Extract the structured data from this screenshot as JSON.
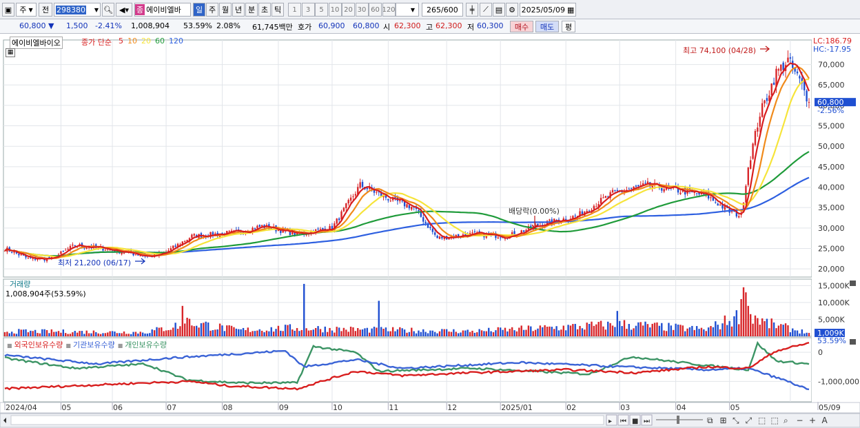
{
  "toolbar": {
    "market": "주",
    "prev_label": "전",
    "code": "298380",
    "type_badge": "종",
    "name": "에이비엘바",
    "periods": [
      "일",
      "주",
      "월",
      "년",
      "분",
      "초",
      "틱"
    ],
    "intervals": [
      "1",
      "3",
      "5",
      "10",
      "20",
      "30",
      "60",
      "120"
    ],
    "count": "265",
    "count_total": "/600",
    "date": "2025/05/09"
  },
  "quote": {
    "price": "60,800",
    "change": "1,500",
    "change_pct": "-2.41%",
    "volume": "1,008,904",
    "volume_ratio": "53.59%",
    "turnover": "2.08%",
    "amount": "61,745백만",
    "bid_label": "호가",
    "bid1": "60,900",
    "bid2": "60,800",
    "open_label": "시",
    "open": "62,300",
    "high_label": "고",
    "high": "62,300",
    "low_label": "저",
    "low": "60,300",
    "buy": "매수",
    "sell": "매도",
    "avg": "평"
  },
  "price_panel": {
    "stock_name": "에이비엘바이오",
    "ma_label": "종가 단순",
    "ma_periods": [
      "5",
      "10",
      "20",
      "60",
      "120"
    ],
    "lc": "LC:186.79",
    "hc": "HC:-17.95",
    "high_note": "최고 74,100 (04/28)",
    "low_note": "최저 21,200 (06/17)",
    "dividend_note": "배당락(0.00%)",
    "current_tag": "60,800",
    "current_pct": "-2.56%"
  },
  "volume_panel": {
    "title": "거래량",
    "value": "1,008,904주(53.59%)",
    "current_tag": "1,009K",
    "current_pct": "53.59%"
  },
  "holdings_panel": {
    "legend": [
      "외국인보유수량",
      "기관보유수량",
      "개인보유수량"
    ]
  },
  "colors": {
    "up": "#d8262a",
    "down": "#1f4fd1",
    "ma5": "#d81e1e",
    "ma10": "#f08a1a",
    "ma20": "#f6e43a",
    "ma60": "#1f9b3a",
    "ma120": "#2d5fe0",
    "foreign": "#d81e1e",
    "institution": "#3a63d6",
    "individual": "#3b9464"
  },
  "chart_data": {
    "type": "candlestick",
    "x": [
      "2024/04",
      "05",
      "06",
      "07",
      "08",
      "09",
      "10",
      "11",
      "12",
      "2025/01",
      "02",
      "03",
      "04",
      "05",
      "05/09"
    ],
    "price_axis": {
      "ylim": [
        18000,
        76000
      ],
      "ticks": [
        "70,000",
        "65,000",
        "60,000",
        "55,000",
        "50,000",
        "45,000",
        "40,000",
        "35,000",
        "30,000",
        "25,000",
        "20,000"
      ]
    },
    "volume_axis": {
      "ticks": [
        "15,000K",
        "10,000K",
        "5,000K"
      ]
    },
    "holdings_axis": {
      "ticks": [
        "0",
        "-1,000,000"
      ]
    },
    "price_anchors": [
      [
        0,
        25000
      ],
      [
        10,
        22500
      ],
      [
        20,
        22500
      ],
      [
        30,
        25800
      ],
      [
        42,
        25000
      ],
      [
        62,
        23000
      ],
      [
        68,
        23800
      ],
      [
        80,
        28000
      ],
      [
        100,
        29000
      ],
      [
        110,
        30500
      ],
      [
        125,
        28500
      ],
      [
        140,
        30000
      ],
      [
        152,
        40500
      ],
      [
        165,
        37000
      ],
      [
        175,
        35000
      ],
      [
        185,
        27500
      ],
      [
        200,
        28500
      ],
      [
        215,
        28000
      ],
      [
        230,
        31000
      ],
      [
        245,
        33000
      ],
      [
        260,
        38500
      ],
      [
        275,
        40500
      ],
      [
        290,
        39000
      ],
      [
        300,
        38000
      ],
      [
        310,
        34000
      ],
      [
        315,
        33000
      ],
      [
        318,
        45000
      ],
      [
        323,
        58000
      ],
      [
        326,
        62000
      ],
      [
        330,
        68000
      ],
      [
        335,
        71000
      ],
      [
        340,
        66000
      ],
      [
        344,
        60800
      ]
    ],
    "volume_anchors": [
      [
        0,
        1500
      ],
      [
        60,
        1200
      ],
      [
        80,
        4000
      ],
      [
        100,
        1800
      ],
      [
        125,
        2500
      ],
      [
        150,
        2000
      ],
      [
        200,
        1500
      ],
      [
        265,
        3500
      ],
      [
        300,
        2000
      ],
      [
        318,
        7000
      ],
      [
        325,
        4000
      ],
      [
        344,
        1009
      ]
    ],
    "volume_spikes": [
      [
        76,
        9000
      ],
      [
        78,
        5500
      ],
      [
        128,
        15500
      ],
      [
        160,
        10500
      ],
      [
        262,
        7500
      ],
      [
        315,
        11000
      ],
      [
        316,
        14500
      ],
      [
        317,
        13000
      ],
      [
        318,
        9000
      ]
    ],
    "foreign_anchors": [
      [
        0,
        -1250000
      ],
      [
        30,
        -1150000
      ],
      [
        60,
        -1050000
      ],
      [
        80,
        -1000000
      ],
      [
        95,
        -1150000
      ],
      [
        125,
        -1250000
      ],
      [
        150,
        -650000
      ],
      [
        170,
        -800000
      ],
      [
        200,
        -700000
      ],
      [
        240,
        -600000
      ],
      [
        270,
        -700000
      ],
      [
        300,
        -500000
      ],
      [
        318,
        -550000
      ],
      [
        330,
        50000
      ],
      [
        344,
        320000
      ]
    ],
    "institution_anchors": [
      [
        0,
        -100000
      ],
      [
        40,
        -400000
      ],
      [
        70,
        -200000
      ],
      [
        120,
        50000
      ],
      [
        128,
        -500000
      ],
      [
        150,
        -250000
      ],
      [
        170,
        -550000
      ],
      [
        220,
        -350000
      ],
      [
        265,
        -500000
      ],
      [
        300,
        -600000
      ],
      [
        318,
        -550000
      ],
      [
        335,
        -1000000
      ],
      [
        344,
        -1300000
      ]
    ],
    "individual_anchors": [
      [
        0,
        -200000
      ],
      [
        30,
        -550000
      ],
      [
        60,
        -400000
      ],
      [
        78,
        -950000
      ],
      [
        100,
        -1050000
      ],
      [
        125,
        -1050000
      ],
      [
        132,
        200000
      ],
      [
        150,
        0
      ],
      [
        160,
        -650000
      ],
      [
        200,
        -550000
      ],
      [
        250,
        -750000
      ],
      [
        268,
        -150000
      ],
      [
        300,
        -450000
      ],
      [
        318,
        -600000
      ],
      [
        322,
        300000
      ],
      [
        330,
        -300000
      ],
      [
        344,
        -400000
      ]
    ]
  }
}
